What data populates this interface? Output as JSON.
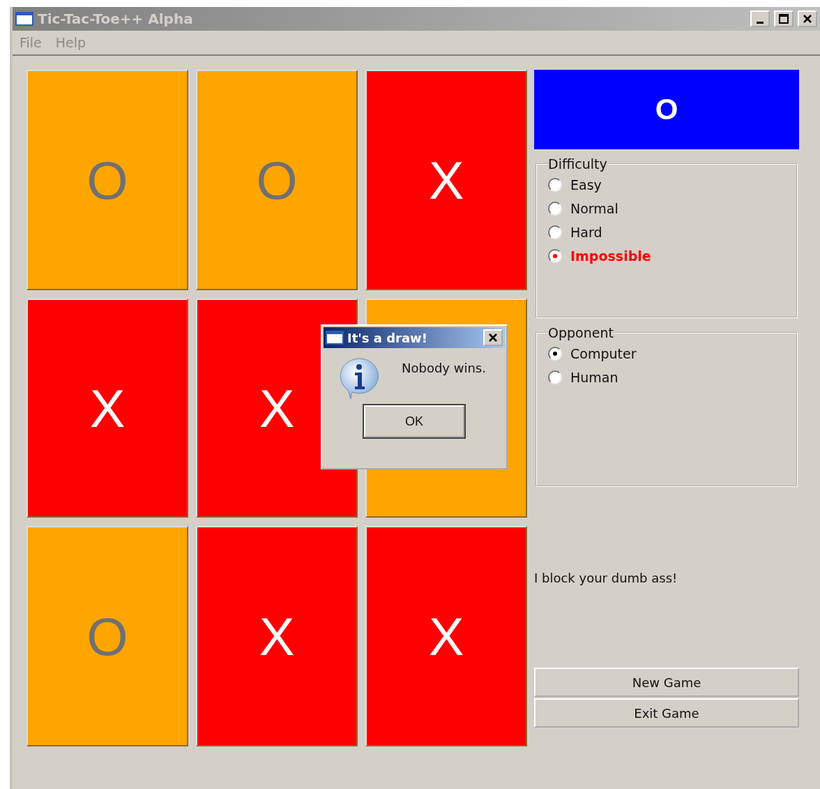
{
  "window": {
    "title": "Tic-Tac-Toe++ Alpha"
  },
  "menu": [
    {
      "label": "File"
    },
    {
      "label": "Help"
    }
  ],
  "board": [
    {
      "mark": "O",
      "color": "#ffa500"
    },
    {
      "mark": "O",
      "color": "#ffa500"
    },
    {
      "mark": "X",
      "color": "#ff0000"
    },
    {
      "mark": "X",
      "color": "#ff0000"
    },
    {
      "mark": "X",
      "color": "#ff0000"
    },
    {
      "color": "#ffa500"
    },
    {
      "mark": "O",
      "color": "#ffa500"
    },
    {
      "mark": "X",
      "color": "#ff0000"
    },
    {
      "mark": "X",
      "color": "#ff0000"
    }
  ],
  "turn": {
    "label": "O"
  },
  "difficulty": {
    "title": "Difficulty",
    "options": [
      {
        "label": "Easy",
        "selected": false,
        "highlighted": false
      },
      {
        "label": "Normal",
        "selected": false,
        "highlighted": false
      },
      {
        "label": "Hard",
        "selected": false,
        "highlighted": false
      },
      {
        "label": "Impossible",
        "selected": true,
        "highlighted": true
      }
    ]
  },
  "opponent": {
    "title": "Opponent",
    "options": [
      {
        "label": "Computer",
        "selected": true,
        "highlighted": false
      },
      {
        "label": "Human",
        "selected": false,
        "highlighted": false
      }
    ]
  },
  "message": "I block your dumb ass!",
  "buttons": [
    {
      "label": "New Game"
    },
    {
      "label": "Exit Game"
    }
  ],
  "dialog": {
    "title": "It's a draw!",
    "text": "Nobody wins.",
    "button": "OK"
  }
}
